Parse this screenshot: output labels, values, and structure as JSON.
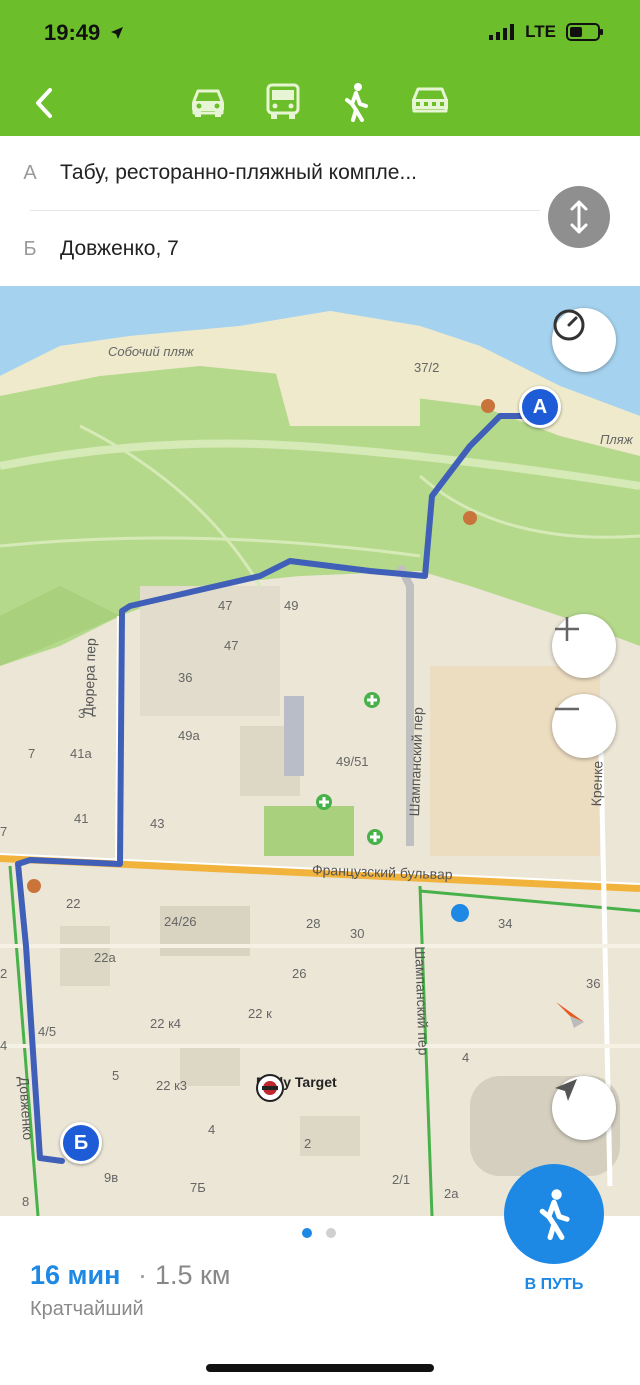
{
  "status": {
    "time": "19:49",
    "network": "LTE"
  },
  "transport_modes": [
    {
      "icon": "car-icon"
    },
    {
      "icon": "bus-icon"
    },
    {
      "icon": "walk-icon"
    },
    {
      "icon": "taxi-icon"
    }
  ],
  "route": {
    "from_letter": "А",
    "from_text": "Табу, ресторанно-пляжный компле...",
    "to_letter": "Б",
    "to_text": "Довженко, 7"
  },
  "map": {
    "labels": {
      "beach": "Собочий пляж",
      "plyazh": "Пляж",
      "b372": "37/2",
      "b47a": "47",
      "b49": "49",
      "b47b": "47",
      "b36": "36",
      "b49a": "49а",
      "b4951": "49/51",
      "b3": "3",
      "b7": "7",
      "b41a": "41а",
      "b41": "41",
      "b43": "43",
      "b7left": "7",
      "b22": "22",
      "b2426": "24/26",
      "b28": "28",
      "b30": "30",
      "b34": "34",
      "b22a": "22а",
      "b26": "26",
      "b36r": "36",
      "b22k4": "22 к4",
      "b22k": "22 к",
      "b45": "4/5",
      "b5": "5",
      "b22k3": "22 к3",
      "b4": "4",
      "b2": "2",
      "b9v": "9в",
      "b7b": "7Б",
      "b21": "2/1",
      "b2a": "2а",
      "b4r": "4",
      "b2left": "2",
      "b4left": "4",
      "b8": "8"
    },
    "streets": {
      "dyurevskiy": "Дюрера пер",
      "shampanskiy": "Шампанский пер",
      "shampanskiy2": "Шампанский пер",
      "frantsuzskiy": "Французский бульвар",
      "dovzhenko": "Довженко",
      "krenk": "Кренке"
    },
    "poi": "Body Target",
    "marker_a": "A",
    "marker_b": "Б"
  },
  "summary": {
    "time": "16 мин",
    "separator": "·",
    "distance": "1.5 км",
    "kind": "Кратчайший",
    "go_label": "В ПУТЬ"
  },
  "colors": {
    "brand": "#6cbf2a",
    "route": "#3f5fb8",
    "accent": "#1e88e5"
  }
}
